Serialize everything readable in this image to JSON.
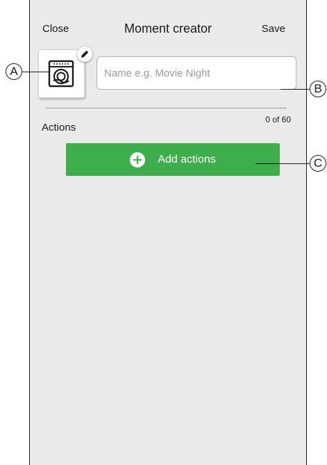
{
  "header": {
    "close_label": "Close",
    "title": "Moment creator",
    "save_label": "Save"
  },
  "moment": {
    "icon": "dishwasher-icon",
    "edit_icon": "pencil-icon"
  },
  "name_input": {
    "placeholder": "Name e.g. Movie Night",
    "value": ""
  },
  "actions": {
    "label": "Actions",
    "counter": "0 of 60"
  },
  "add_button": {
    "label": "Add actions",
    "icon": "plus-circle-icon",
    "color": "#3dae4b"
  },
  "callouts": {
    "a": "A",
    "b": "B",
    "c": "C"
  }
}
